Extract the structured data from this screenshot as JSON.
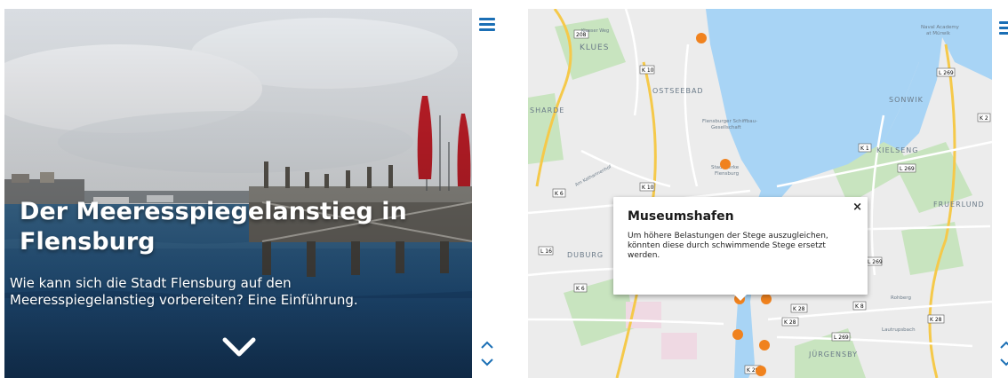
{
  "hero": {
    "title": "Der Meeresspiegelanstieg in Flensburg",
    "subtitle": "Wie kann sich die Stadt Flensburg auf den Meeresspiegelanstieg vorbereiten? Eine Einführung."
  },
  "icons": {
    "menu": "hamburger-menu-icon",
    "scroll_down": "chevron-down-icon",
    "nav_up": "chevron-up-icon",
    "nav_down": "chevron-down-icon"
  },
  "colors": {
    "menu_blue": "#1b6fb5",
    "marker_orange": "#f0821e",
    "water_blue": "#a8d4f5"
  },
  "map": {
    "labels": {
      "klues": "KLUES",
      "klueser_weg": "Klueser Weg",
      "ostseebad": "OSTSEEBAD",
      "sharde": "SHARDE",
      "schiffbau": "Flensburger Schiffbau-Gesellschaft",
      "schiffbau_line1": "Flensburger Schiffbau-",
      "schiffbau_line2": "Gesellschaft",
      "stadtwerke": "Stadtwerke",
      "flensburg": "Flensburg",
      "sonwik": "SONWIK",
      "kielseng": "KIELSENG",
      "fruerlund": "FRUERLUND",
      "duburg": "DUBURG",
      "juergensby": "JÜRGENSBY",
      "naval_academy_1": "Naval Academy",
      "naval_academy_2": "at Mürwik",
      "lautrupsbach": "Lautrupsbach",
      "rohberg": "Rohberg",
      "am_katharinenhof": "Am Katharinenhof",
      "road_208": "208",
      "road_k10a": "K 10",
      "road_k10b": "K 10",
      "road_k6": "K 6",
      "road_l16": "L 16",
      "road_k6b": "K 6",
      "road_l269a": "L 269",
      "road_l269b": "L 269",
      "road_l269c": "L 269",
      "road_k1": "K 1",
      "road_k2": "K 2",
      "road_k8": "K 8",
      "road_k28a": "K 28",
      "road_k28b": "K 28",
      "road_k28c": "K 28",
      "road_l269d": "L 269",
      "road_k29": "K 29"
    },
    "popup": {
      "title": "Museumshafen",
      "body": "Um höhere Belastungen der Stege auszugleichen, könnten diese durch schwimmende Stege ersetzt werden.",
      "close": "×"
    }
  }
}
